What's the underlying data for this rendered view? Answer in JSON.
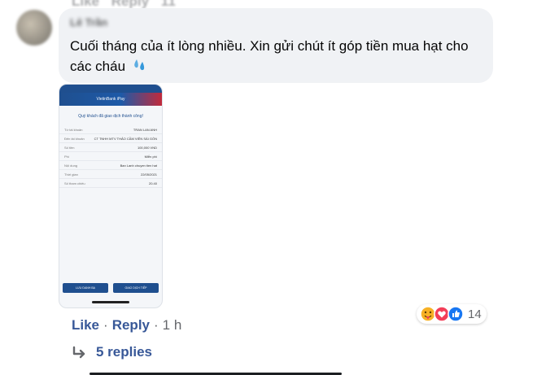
{
  "top_faded": {
    "like": "Like",
    "reply": "Reply",
    "time": "11"
  },
  "comment": {
    "author": "Lê Trần",
    "text": "Cuối tháng của ít lòng nhiều. Xin gửi chút ít góp tiền mua hạt cho các cháu",
    "emoji": "sweat-droplets-icon"
  },
  "attachment": {
    "app_title": "VietinBank iPay",
    "success_text": "Quý khách đã giao dịch thành công!",
    "rows": [
      {
        "label": "Từ tài khoản",
        "value": "TRAN LAN ANH"
      },
      {
        "label": "Đến tài khoản",
        "value": "CT TNHH MTV THẢO CẦM VIÊN SÀI GÒN"
      },
      {
        "label": "Số tiền",
        "value": "100,000 VND"
      },
      {
        "label": "Phí",
        "value": "Miễn phí"
      },
      {
        "label": "Nội dung",
        "value": "Ban Lanh chuyen tien hat"
      },
      {
        "label": "Thời gian",
        "value": "22/05/2021"
      },
      {
        "label": "Số tham chiếu",
        "value": "20.40"
      }
    ],
    "btn_save": "LƯU DANH BẠ",
    "btn_new": "GIAO DỊCH TIẾP"
  },
  "reactions": {
    "count": "14",
    "icons": [
      "care-icon",
      "love-icon",
      "like-icon"
    ],
    "colors": {
      "love": "#f33e58",
      "like": "#1877f2",
      "care": "#f7b125"
    }
  },
  "actions": {
    "like": "Like",
    "separator": "·",
    "reply": "Reply",
    "time": "1 h"
  },
  "replies": {
    "label": "5 replies"
  },
  "colors": {
    "link": "#385898",
    "bubble": "#f0f2f5",
    "muted": "#65676b"
  }
}
